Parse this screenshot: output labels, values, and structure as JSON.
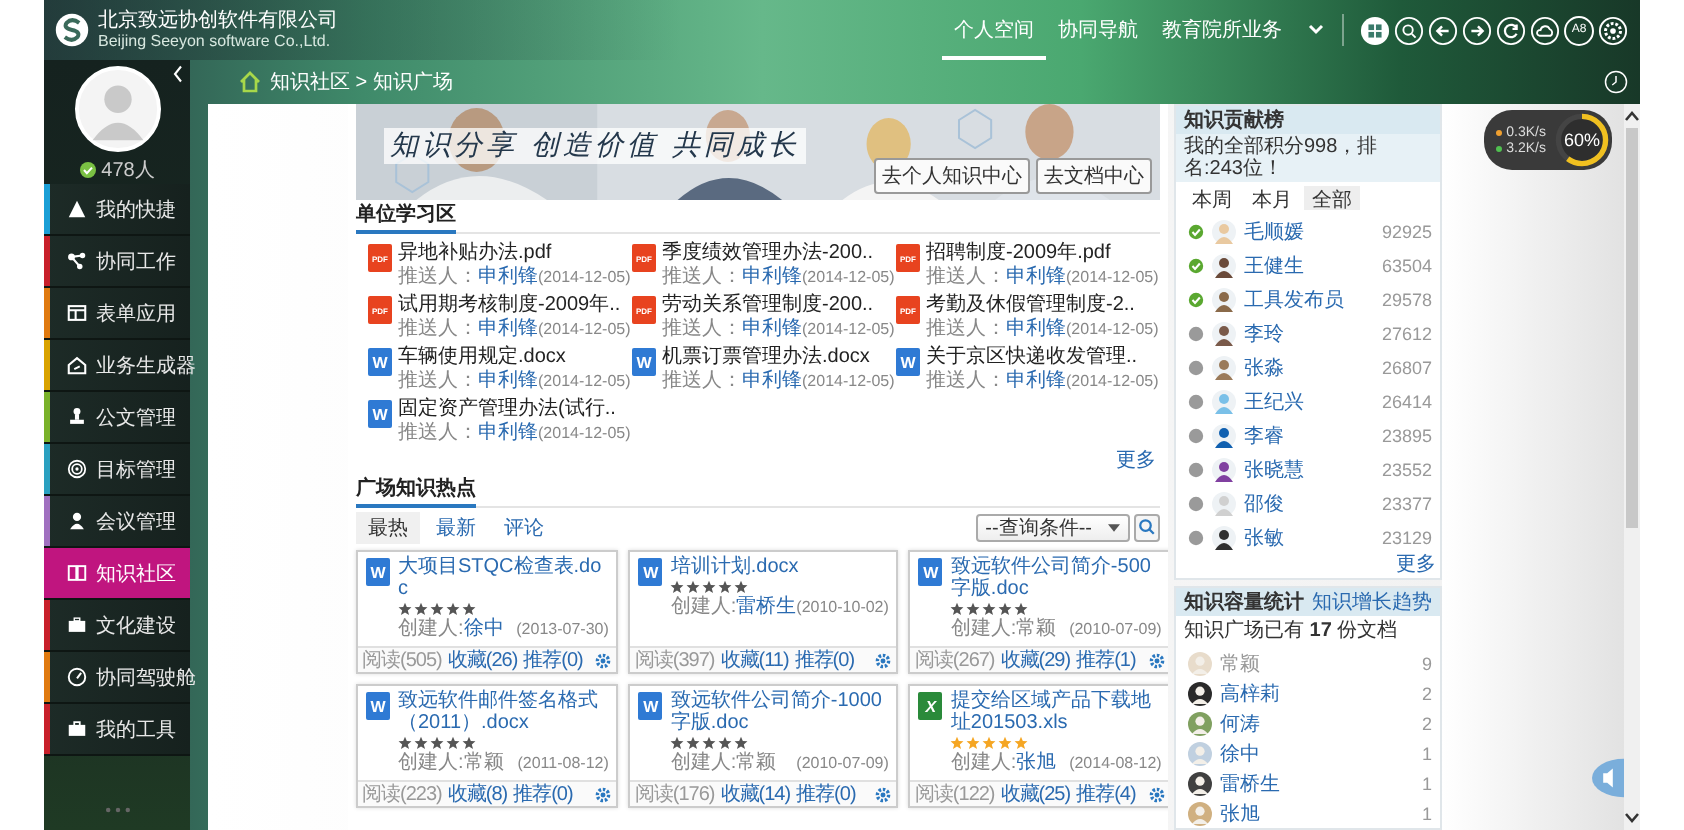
{
  "header": {
    "company": "北京致远协创软件有限公司",
    "company_en": "Beijing Seeyon software Co.,Ltd.",
    "nav": [
      {
        "label": "个人空间",
        "selected": true
      },
      {
        "label": "协同导航",
        "selected": false
      },
      {
        "label": "教育院所业务",
        "selected": false
      }
    ],
    "tools": [
      {
        "kind": "apps"
      },
      {
        "kind": "search"
      },
      {
        "kind": "back"
      },
      {
        "kind": "forward"
      },
      {
        "kind": "refresh"
      },
      {
        "kind": "cloud"
      },
      {
        "kind": "text",
        "label": "A8"
      },
      {
        "kind": "settings"
      }
    ]
  },
  "sidebar": {
    "status": "478人",
    "online": true,
    "items": [
      {
        "label": "我的快捷",
        "color": "#1b9fd6",
        "selected": false
      },
      {
        "label": "协同工作",
        "color": "#c8202a",
        "selected": false
      },
      {
        "label": "表单应用",
        "color": "#e07a10",
        "selected": false
      },
      {
        "label": "业务生成器",
        "color": "#d9a300",
        "selected": false
      },
      {
        "label": "公文管理",
        "color": "#7ab22a",
        "selected": false
      },
      {
        "label": "目标管理",
        "color": "#2aa0c0",
        "selected": false
      },
      {
        "label": "会议管理",
        "color": "#a070c0",
        "selected": false
      },
      {
        "label": "知识社区",
        "color": "#c0157f",
        "selected": true
      },
      {
        "label": "文化建设",
        "color": "#c8202a",
        "selected": false
      },
      {
        "label": "协同驾驶舱",
        "color": "#e07a10",
        "selected": false
      },
      {
        "label": "我的工具",
        "color": "#c8202a",
        "selected": false
      }
    ]
  },
  "breadcrumb": "知识社区 > 知识广场",
  "banner": {
    "slogan": "知识分享 创造价值 共同成长",
    "buttons": [
      "去个人知识中心",
      "去文档中心"
    ]
  },
  "unit_study": {
    "title": "单位学习区",
    "more": "更多",
    "files": [
      {
        "kind": "pdf",
        "badge": "PDF",
        "name": "异地补贴办法.pdf",
        "pusher_label": "推送人：",
        "pusher": "申利锋",
        "date": "(2014-12-05)"
      },
      {
        "kind": "pdf",
        "badge": "PDF",
        "name": "季度绩效管理办法-200..",
        "pusher_label": "推送人：",
        "pusher": "申利锋",
        "date": "(2014-12-05)"
      },
      {
        "kind": "pdf",
        "badge": "PDF",
        "name": "招聘制度-2009年.pdf",
        "pusher_label": "推送人：",
        "pusher": "申利锋",
        "date": "(2014-12-05)"
      },
      {
        "kind": "pdf",
        "badge": "PDF",
        "name": "试用期考核制度-2009年..",
        "pusher_label": "推送人：",
        "pusher": "申利锋",
        "date": "(2014-12-05)"
      },
      {
        "kind": "pdf",
        "badge": "PDF",
        "name": "劳动关系管理制度-200..",
        "pusher_label": "推送人：",
        "pusher": "申利锋",
        "date": "(2014-12-05)"
      },
      {
        "kind": "pdf",
        "badge": "PDF",
        "name": "考勤及休假管理制度-2..",
        "pusher_label": "推送人：",
        "pusher": "申利锋",
        "date": "(2014-12-05)"
      },
      {
        "kind": "word",
        "badge": "W",
        "name": "车辆使用规定.docx",
        "pusher_label": "推送人：",
        "pusher": "申利锋",
        "date": "(2014-12-05)"
      },
      {
        "kind": "word",
        "badge": "W",
        "name": "机票订票管理办法.docx",
        "pusher_label": "推送人：",
        "pusher": "申利锋",
        "date": "(2014-12-05)"
      },
      {
        "kind": "word",
        "badge": "W",
        "name": "关于京区快递收发管理..",
        "pusher_label": "推送人：",
        "pusher": "申利锋",
        "date": "(2014-12-05)"
      },
      {
        "kind": "word",
        "badge": "W",
        "name": "固定资产管理办法(试行..",
        "pusher_label": "推送人：",
        "pusher": "申利锋",
        "date": "(2014-12-05)"
      }
    ]
  },
  "hot": {
    "title": "广场知识热点",
    "filter": "--查询条件--",
    "tabs": [
      {
        "label": "最热",
        "selected": true
      },
      {
        "label": "最新",
        "selected": false
      },
      {
        "label": "评论",
        "selected": false
      }
    ],
    "cards": [
      {
        "kind": "word",
        "badge": "W",
        "title": "大项目STQC检查表.doc",
        "stars": 5,
        "highlighted": false,
        "creator_label": "创建人:",
        "creator": "徐中",
        "linked": true,
        "date": "(2013-07-30)",
        "reads": "阅读(505)",
        "favorites": "收藏(26)",
        "recommends": "推荐(0)"
      },
      {
        "kind": "word",
        "badge": "W",
        "title": "培训计划.docx",
        "stars": 5,
        "highlighted": false,
        "creator_label": "创建人:",
        "creator": "雷桥生",
        "linked": true,
        "date": "(2010-10-02)",
        "reads": "阅读(397)",
        "favorites": "收藏(11)",
        "recommends": "推荐(0)"
      },
      {
        "kind": "word",
        "badge": "W",
        "title": "致远软件公司简介-500字版.doc",
        "stars": 5,
        "highlighted": false,
        "creator_label": "创建人:",
        "creator": "常颖",
        "linked": false,
        "date": "(2010-07-09)",
        "reads": "阅读(267)",
        "favorites": "收藏(29)",
        "recommends": "推荐(1)"
      },
      {
        "kind": "word",
        "badge": "W",
        "title": "致远软件邮件签名格式（2011）.docx",
        "stars": 5,
        "highlighted": false,
        "creator_label": "创建人:",
        "creator": "常颖",
        "linked": false,
        "date": "(2011-08-12)",
        "reads": "阅读(223)",
        "favorites": "收藏(8)",
        "recommends": "推荐(0)"
      },
      {
        "kind": "word",
        "badge": "W",
        "title": "致远软件公司简介-1000字版.doc",
        "stars": 5,
        "highlighted": false,
        "creator_label": "创建人:",
        "creator": "常颖",
        "linked": false,
        "date": "(2010-07-09)",
        "reads": "阅读(176)",
        "favorites": "收藏(14)",
        "recommends": "推荐(0)"
      },
      {
        "kind": "excel",
        "badge": "X",
        "title": "提交给区域产品下载地址201503.xls",
        "stars": 5,
        "highlighted": true,
        "creator_label": "创建人:",
        "creator": "张旭",
        "linked": true,
        "date": "(2014-08-12)",
        "reads": "阅读(122)",
        "favorites": "收藏(25)",
        "recommends": "推荐(4)"
      }
    ]
  },
  "ranking": {
    "title": "知识贡献榜",
    "summary": "我的全部积分998，排名:243位！",
    "more": "更多",
    "tabs": [
      {
        "label": "本周",
        "selected": false
      },
      {
        "label": "本月",
        "selected": false
      },
      {
        "label": "全部",
        "selected": true
      }
    ],
    "rows": [
      {
        "name": "毛顺媛",
        "score": "92925",
        "online": true
      },
      {
        "name": "王健生",
        "score": "63504",
        "online": true
      },
      {
        "name": "工具发布员",
        "score": "29578",
        "online": true
      },
      {
        "name": "李玲",
        "score": "27612",
        "online": false
      },
      {
        "name": "张淼",
        "score": "26807",
        "online": false
      },
      {
        "name": "王纪兴",
        "score": "26414",
        "online": false
      },
      {
        "name": "李睿",
        "score": "23895",
        "online": false
      },
      {
        "name": "张晓慧",
        "score": "23552",
        "online": false
      },
      {
        "name": "邵俊",
        "score": "23377",
        "online": false
      },
      {
        "name": "张敏",
        "score": "23129",
        "online": false
      }
    ]
  },
  "capacity": {
    "title": "知识容量统计",
    "trend_link": "知识增长趋势",
    "summary": "知识广场已有 **17** 份文档",
    "rows": [
      {
        "name": "常颖",
        "count": "9",
        "linked": false
      },
      {
        "name": "高梓莉",
        "count": "2",
        "linked": true
      },
      {
        "name": "何涛",
        "count": "2",
        "linked": true
      },
      {
        "name": "徐中",
        "count": "1",
        "linked": true
      },
      {
        "name": "雷桥生",
        "count": "1",
        "linked": true
      },
      {
        "name": "张旭",
        "count": "1",
        "linked": true
      }
    ]
  },
  "net_monitor": {
    "upload": "0.3K/s",
    "download": "3.2K/s",
    "percent": "60%",
    "level": 0.6
  }
}
